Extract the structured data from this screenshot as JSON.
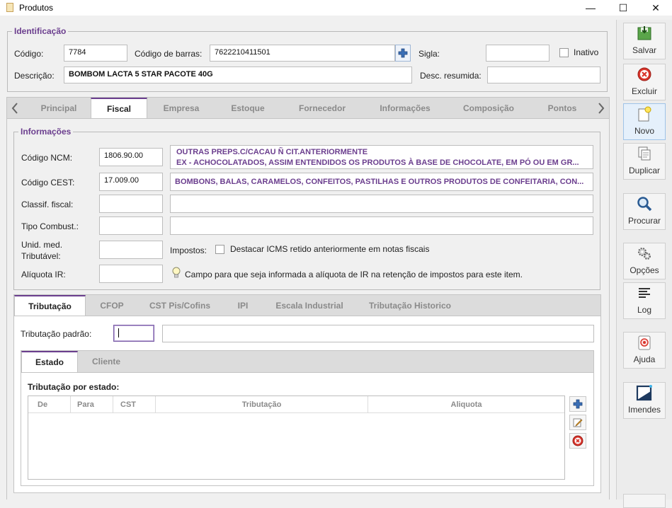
{
  "window": {
    "title": "Produtos",
    "minimize": "—",
    "maximize": "☐",
    "close": "✕"
  },
  "identificacao": {
    "legend": "Identificação",
    "codigo_label": "Código:",
    "codigo_value": "7784",
    "barras_label": "Código de barras:",
    "barras_value": "7622210411501",
    "sigla_label": "Sigla:",
    "sigla_value": "",
    "inativo_label": "Inativo",
    "descricao_label": "Descrição:",
    "descricao_value": "BOMBOM LACTA 5 STAR PACOTE 40G",
    "desc_resumida_label": "Desc. resumida:",
    "desc_resumida_value": ""
  },
  "main_tabs": [
    {
      "label": "Principal"
    },
    {
      "label": "Fiscal"
    },
    {
      "label": "Empresa"
    },
    {
      "label": "Estoque"
    },
    {
      "label": "Fornecedor"
    },
    {
      "label": "Informações"
    },
    {
      "label": "Composição"
    },
    {
      "label": "Pontos"
    }
  ],
  "informacoes": {
    "legend": "Informações",
    "ncm_label": "Código NCM:",
    "ncm_value": "1806.90.00",
    "ncm_desc_line1": "OUTRAS PREPS.C/CACAU Ñ CIT.ANTERIORMENTE",
    "ncm_desc_line2": "EX - ACHOCOLATADOS, ASSIM ENTENDIDOS OS PRODUTOS À BASE DE CHOCOLATE, EM PÓ OU EM GR...",
    "cest_label": "Código CEST:",
    "cest_value": "17.009.00",
    "cest_desc": "BOMBONS, BALAS, CARAMELOS, CONFEITOS, PASTILHAS E OUTROS PRODUTOS DE CONFEITARIA, CON...",
    "classif_label": "Classif. fiscal:",
    "classif_value": "",
    "classif_desc": "",
    "combust_label": "Tipo Combust.:",
    "combust_value": "",
    "combust_desc": "",
    "unid_label_1": "Unid. med.",
    "unid_label_2": "Tributável:",
    "unid_value": "",
    "impostos_label": "Impostos:",
    "destacar_label": "Destacar ICMS retido anteriormente em notas fiscais",
    "aliquota_label": "Alíquota IR:",
    "aliquota_value": "",
    "aliquota_hint": "Campo para que seja informada a alíquota de IR na retenção de impostos para este item."
  },
  "sub_tabs": [
    {
      "label": "Tributação"
    },
    {
      "label": "CFOP"
    },
    {
      "label": "CST Pis/Cofins"
    },
    {
      "label": "IPI"
    },
    {
      "label": "Escala Industrial"
    },
    {
      "label": "Tributação Historico"
    }
  ],
  "tributacao": {
    "padrao_label": "Tributação padrão:",
    "padrao_value": "",
    "padrao_desc": "",
    "inner_tabs": [
      {
        "label": "Estado"
      },
      {
        "label": "Cliente"
      }
    ],
    "por_estado_label": "Tributação por estado:",
    "columns": [
      "De",
      "Para",
      "CST",
      "Tributação",
      "Aliquota"
    ]
  },
  "toolbar": [
    {
      "label": "Salvar",
      "icon": "save-icon"
    },
    {
      "label": "Excluir",
      "icon": "delete-icon"
    },
    {
      "label": "Novo",
      "icon": "new-icon"
    },
    {
      "label": "Duplicar",
      "icon": "duplicate-icon"
    },
    {
      "label": "Procurar",
      "icon": "search-icon"
    },
    {
      "label": "Opções",
      "icon": "gears-icon"
    },
    {
      "label": "Log",
      "icon": "log-icon"
    },
    {
      "label": "Ajuda",
      "icon": "help-icon"
    },
    {
      "label": "Imendes",
      "icon": "imendes-icon"
    }
  ]
}
